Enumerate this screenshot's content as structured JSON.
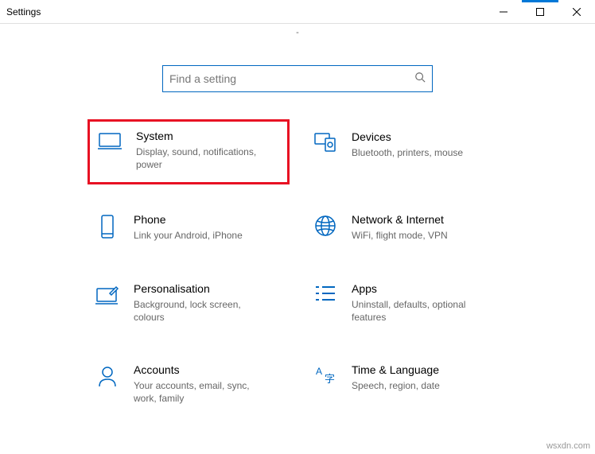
{
  "window": {
    "title": "Settings"
  },
  "search": {
    "placeholder": "Find a setting"
  },
  "tiles": {
    "system": {
      "title": "System",
      "desc": "Display, sound, notifications, power"
    },
    "devices": {
      "title": "Devices",
      "desc": "Bluetooth, printers, mouse"
    },
    "phone": {
      "title": "Phone",
      "desc": "Link your Android, iPhone"
    },
    "network": {
      "title": "Network & Internet",
      "desc": "WiFi, flight mode, VPN"
    },
    "personal": {
      "title": "Personalisation",
      "desc": "Background, lock screen, colours"
    },
    "apps": {
      "title": "Apps",
      "desc": "Uninstall, defaults, optional features"
    },
    "accounts": {
      "title": "Accounts",
      "desc": "Your accounts, email, sync, work, family"
    },
    "time": {
      "title": "Time & Language",
      "desc": "Speech, region, date"
    }
  },
  "watermark": "wsxdn.com",
  "dash": "-"
}
